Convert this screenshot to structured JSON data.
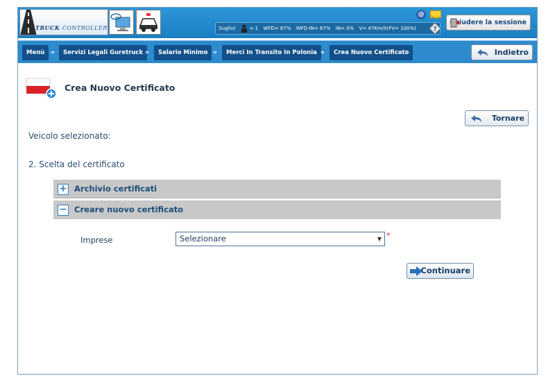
{
  "header": {
    "logo_text_bold": "TRUCK",
    "logo_text_thin": "CONTROLLER",
    "stats": {
      "period": "(luglio)",
      "drivers": "= 1",
      "wfd": "WFD= 67%",
      "wfd_in": "WFD-IN= 67%",
      "in": "IN= 0%",
      "v": "V= 47Km/h(FV= 100%)"
    },
    "logout_label": "Chiudere la sessione"
  },
  "breadcrumb": {
    "items": [
      "Menù",
      "Servizi Legali Guretruck",
      "Salario Minimo",
      "Merci In Transito In Polonia",
      "Crea Nuovo Certificato"
    ],
    "separator": "»",
    "back_label": "Indietro"
  },
  "page": {
    "title": "Crea Nuovo Certificato",
    "return_label": "Tornare",
    "vehicle_label": "Veicolo selezionato:",
    "step_label": "2. Scelta del certificato",
    "panels": [
      {
        "label": "Archivio certificati",
        "toggle": "+"
      },
      {
        "label": "Creare nuovo certificato",
        "toggle": "−"
      }
    ],
    "company_field": {
      "label": "Imprese",
      "value": "Selezionare",
      "required_mark": "*"
    },
    "continue_label": "Continuare"
  },
  "colors": {
    "header_blue": "#1a7fc2",
    "crumb_dark": "#11508a",
    "panel_gray": "#c8c8c8",
    "required_red": "#dd2222"
  }
}
